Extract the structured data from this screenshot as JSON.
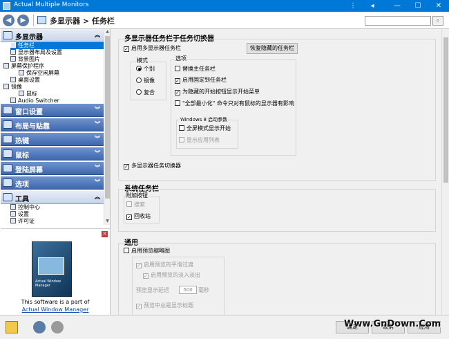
{
  "window": {
    "title": "Actual Multiple Monitors",
    "controls": [
      "⋮",
      "◂",
      "—",
      "☐",
      "✕"
    ]
  },
  "nav": {
    "back_icon": "back-arrow-icon",
    "forward_icon": "forward-arrow-icon",
    "breadcrumb": "多显示器 > 任务栏",
    "search_placeholder": ""
  },
  "sidebar": {
    "groups": [
      {
        "label": "多显示器",
        "icon": "monitors-icon",
        "state": "open",
        "items": [
          {
            "label": "任务栏",
            "selected": true
          },
          {
            "label": "显示器布局及设置"
          },
          {
            "label": "背景图片"
          },
          {
            "label": "屏幕保护程序"
          },
          {
            "label": "保存空闲屏幕"
          },
          {
            "label": "桌面设置"
          },
          {
            "label": "镜像"
          },
          {
            "label": "鼠标"
          },
          {
            "label": "Audio Switcher"
          }
        ]
      },
      {
        "label": "窗口设置",
        "icon": "window-icon"
      },
      {
        "label": "布局与贴靠",
        "icon": "layout-icon"
      },
      {
        "label": "热键",
        "icon": "keyboard-icon"
      },
      {
        "label": "鼠标",
        "icon": "mouse-icon"
      },
      {
        "label": "登陆屏幕",
        "icon": "key-icon"
      },
      {
        "label": "选项",
        "icon": "options-icon"
      },
      {
        "label": "工具",
        "icon": "tools-icon",
        "state": "open",
        "items": [
          {
            "label": "控制中心"
          },
          {
            "label": "设置"
          },
          {
            "label": "许可证"
          }
        ]
      }
    ],
    "promo": {
      "product": "Actual Window Manager",
      "line1": "This software is a part of",
      "link": "Actual Window Manager"
    }
  },
  "content": {
    "section1": {
      "title": "多显示器任务栏于任务切换器",
      "enable_taskbar": {
        "label": "启用多显示器任务栏",
        "checked": true
      },
      "restore_button": "恢复隐藏的任务栏",
      "mode": {
        "label": "模式",
        "options": [
          {
            "label": "个别",
            "selected": true
          },
          {
            "label": "镜像",
            "selected": false
          },
          {
            "label": "复合",
            "selected": false
          }
        ]
      },
      "options": {
        "label": "选项",
        "items": [
          {
            "label": "替换主任务栏",
            "checked": false
          },
          {
            "label": "启用固定到任务栏",
            "checked": true
          },
          {
            "label": "为隐藏的开始按钮显示开始菜单",
            "checked": true
          },
          {
            "label": "\"全部最小化\" 命令只对有鼠标的显示器有影响",
            "checked": false
          }
        ]
      },
      "win8": {
        "label": "Windows 8 启动参数",
        "items": [
          {
            "label": "全屏模式显示开始",
            "checked": false,
            "disabled": false
          },
          {
            "label": "显示应用列表",
            "checked": false,
            "disabled": true
          }
        ]
      },
      "task_switcher": {
        "label": "多显示器任务切换器",
        "checked": true
      }
    },
    "section2": {
      "title": "系统任务栏",
      "extra_buttons": {
        "label": "附加按钮",
        "items": [
          {
            "label": "搜索",
            "checked": false,
            "disabled": true
          },
          {
            "label": "回收站",
            "checked": true,
            "disabled": false
          }
        ]
      }
    },
    "section3": {
      "title": "通用",
      "enable_preview": {
        "label": "启用预览缩略图",
        "checked": false
      },
      "smooth": {
        "label": "启用预览的平滑过渡",
        "checked": true,
        "disabled": true
      },
      "fade": {
        "label": "启用预览的淡入淡出",
        "checked": true,
        "disabled": true
      },
      "delay": {
        "label": "预览显示延迟",
        "value": "500",
        "unit": "毫秒"
      },
      "always_title": {
        "label": "预览中总是显示标题",
        "checked": true,
        "disabled": true
      }
    }
  },
  "bottom": {
    "ok": "确定",
    "cancel": "取消",
    "apply": "应用",
    "watermark": "Www.GnDown.Com"
  }
}
